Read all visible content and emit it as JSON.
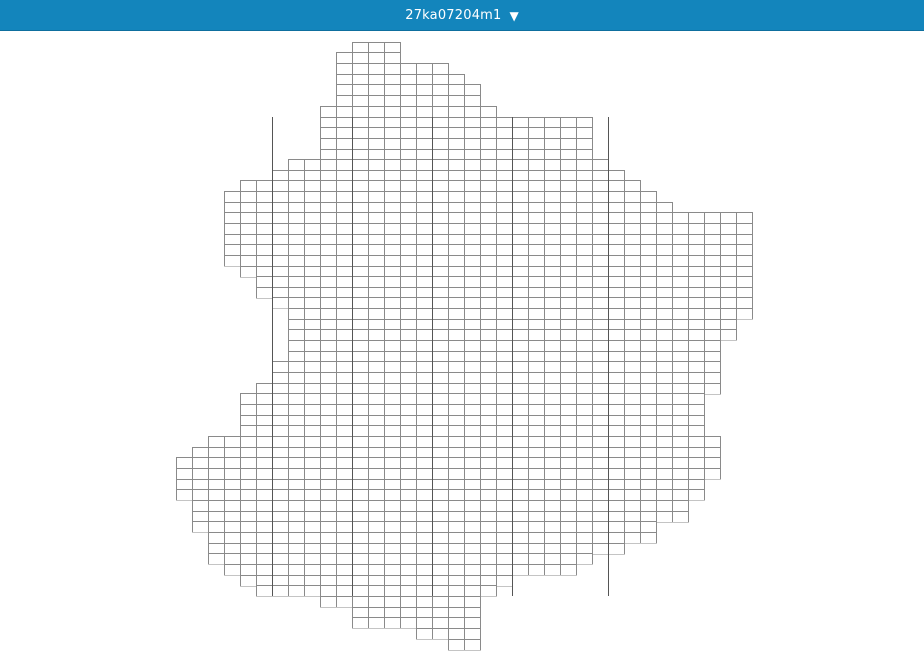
{
  "header": {
    "selector_label": "27ka07204m1",
    "caret_icon": "caret-down-icon",
    "background_color": "#1385bc",
    "text_color": "#ffffff"
  },
  "map": {
    "cell_stroke_color": "#8a8a8a",
    "region_stroke_color": "#555555"
  }
}
